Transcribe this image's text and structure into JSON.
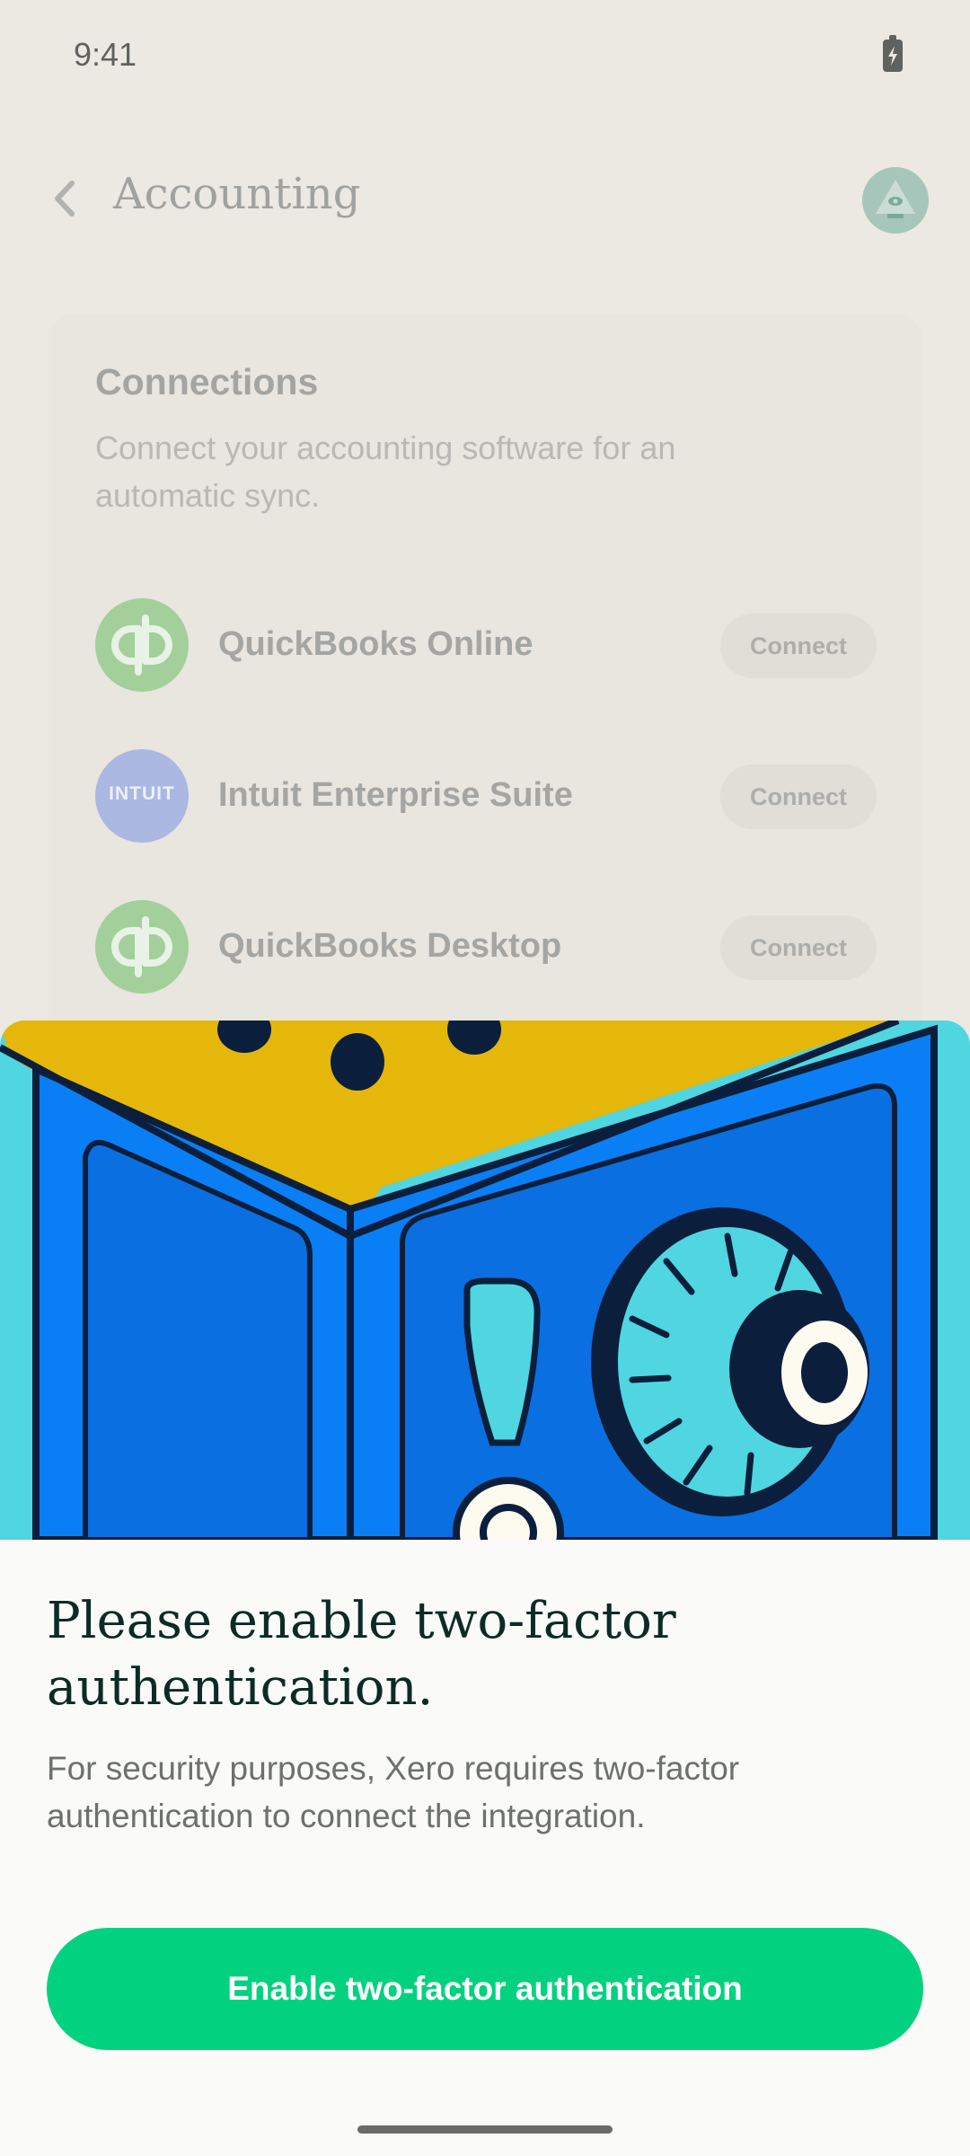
{
  "status_bar": {
    "time": "9:41"
  },
  "header": {
    "title": "Accounting"
  },
  "connections": {
    "title": "Connections",
    "subtitle": "Connect your accounting software for an automatic sync.",
    "items": [
      {
        "name": "QuickBooks Online",
        "logo": "qb",
        "button": "Connect"
      },
      {
        "name": "Intuit Enterprise Suite",
        "logo": "INTUIT",
        "button": "Connect"
      },
      {
        "name": "QuickBooks Desktop",
        "logo": "qb",
        "button": "Connect"
      }
    ]
  },
  "modal": {
    "title": "Please enable two-factor authentication.",
    "body": "For security purposes, Xero requires two-factor authentication to connect the integration.",
    "cta": "Enable two-factor authentication"
  },
  "colors": {
    "accent": "#02d27f",
    "safe_blue": "#0a7ff5",
    "safe_gold": "#e4b70a",
    "backdrop": "#4fd6e0"
  }
}
